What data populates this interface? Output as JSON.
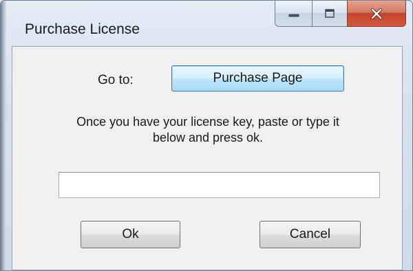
{
  "window": {
    "title": "Purchase License",
    "caption_buttons": {
      "minimize_icon": "minimize-icon",
      "maximize_icon": "maximize-icon",
      "close_icon": "close-icon"
    }
  },
  "form": {
    "goto_label": "Go to:",
    "purchase_button_label": "Purchase Page",
    "instructions_line1": "Once you have your license key, paste or type it",
    "instructions_line2": "below and press ok.",
    "license_key_value": "",
    "ok_button_label": "Ok",
    "cancel_button_label": "Cancel"
  },
  "colors": {
    "close_button": "#c2462c",
    "focused_button_border": "#3c7fb1",
    "content_background": "#f0f0f0"
  }
}
